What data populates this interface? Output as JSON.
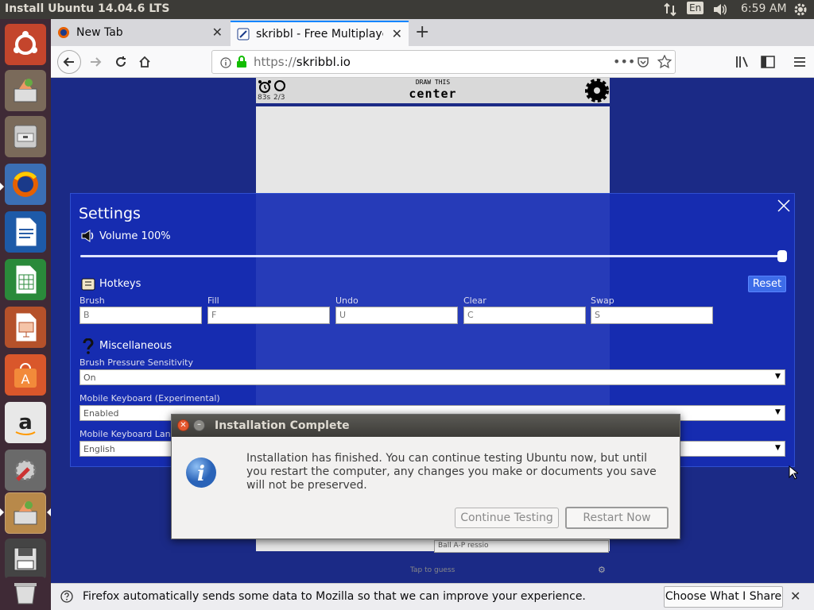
{
  "top_panel": {
    "title": "Install Ubuntu 14.04.6 LTS",
    "keyboard": "En",
    "time": "6:59 AM",
    "icons": [
      "network-arrows-icon",
      "keyboard-icon",
      "volume-icon",
      "gear-icon"
    ]
  },
  "launcher": {
    "items": [
      "ubuntu-dash-icon",
      "installer-icon",
      "files-icon",
      "firefox-icon",
      "writer-icon",
      "calc-icon",
      "impress-icon",
      "software-center-icon",
      "amazon-icon",
      "system-settings-icon",
      "installer-active-icon",
      "floppy-icon",
      "trash-icon"
    ]
  },
  "browser": {
    "tabs": [
      {
        "label": "New Tab",
        "active": false
      },
      {
        "label": "skribbl - Free Multiplaye",
        "active": true
      }
    ],
    "new_tab_symbol": "+",
    "url_scheme": "https://",
    "url_host": "skribbl.io",
    "notification": "Firefox automatically sends some data to Mozilla so that we can improve your experience.",
    "notification_button": "Choose What I Share"
  },
  "game": {
    "timer": "83s",
    "round": "2/3",
    "draw_this_label": "DRAW THIS",
    "word": "center",
    "tap_to_guess": "Tap to guess",
    "chat_placeholder": "Ball A-P ressio"
  },
  "settings": {
    "title": "Settings",
    "volume_label": "Volume 100%",
    "volume_value": 1.0,
    "hotkeys_label": "Hotkeys",
    "reset_label": "Reset",
    "hotkeys": [
      {
        "label": "Brush",
        "value": "B"
      },
      {
        "label": "Fill",
        "value": "F"
      },
      {
        "label": "Undo",
        "value": "U"
      },
      {
        "label": "Clear",
        "value": "C"
      },
      {
        "label": "Swap",
        "value": "S"
      }
    ],
    "misc_label": "Miscellaneous",
    "brush_pressure_label": "Brush Pressure Sensitivity",
    "brush_pressure_value": "On",
    "mobile_keyboard_label": "Mobile Keyboard (Experimental)",
    "mobile_keyboard_value": "Enabled",
    "mobile_keyboard_lang_label": "Mobile Keyboard Langu",
    "mobile_keyboard_lang_value": "English"
  },
  "dialog": {
    "title": "Installation Complete",
    "message": "Installation has finished.  You can continue testing Ubuntu now, but until you restart the computer, any changes you make or documents you save will not be preserved.",
    "continue_label": "Continue Testing",
    "restart_label": "Restart Now"
  },
  "colors": {
    "panel": "#3c3b37",
    "launcher": "#3f2a36",
    "settings_bg": "#162db4",
    "page_bg": "#1b2a86",
    "accent": "#0a84ff"
  }
}
